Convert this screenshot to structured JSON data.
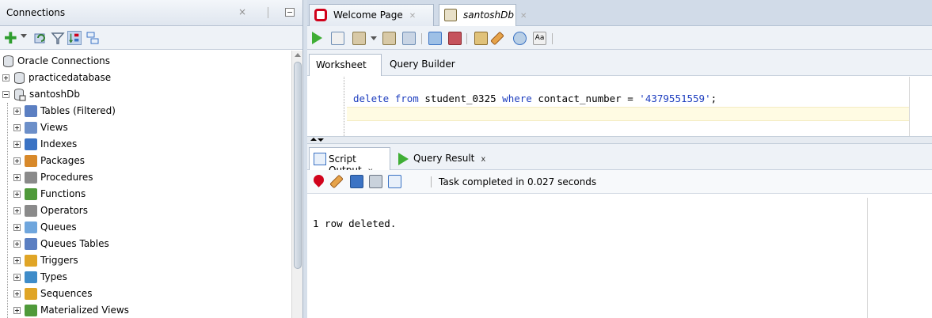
{
  "connections_panel": {
    "title": "Connections",
    "close_glyph": "×",
    "toolbar_icons": [
      "add-connection-icon",
      "refresh-icon",
      "filter-icon",
      "schema-browser-icon",
      "hierarchy-icon"
    ]
  },
  "tree": {
    "root": "Oracle Connections",
    "connections": [
      {
        "label": "practicedatabase",
        "expanded": false
      },
      {
        "label": "santoshDb",
        "expanded": true
      }
    ],
    "children": [
      {
        "label": "Tables (Filtered)",
        "icon": "tables-icon",
        "color": "#5b7fc2"
      },
      {
        "label": "Views",
        "icon": "views-icon",
        "color": "#6c8fc9"
      },
      {
        "label": "Indexes",
        "icon": "indexes-icon",
        "color": "#3b73c4"
      },
      {
        "label": "Packages",
        "icon": "packages-icon",
        "color": "#d8892a"
      },
      {
        "label": "Procedures",
        "icon": "procedures-icon",
        "color": "#7a7a7a"
      },
      {
        "label": "Functions",
        "icon": "functions-icon",
        "color": "#4f9a3a"
      },
      {
        "label": "Operators",
        "icon": "operators-icon",
        "color": "#7a7a7a"
      },
      {
        "label": "Queues",
        "icon": "queues-icon",
        "color": "#6fa6dd"
      },
      {
        "label": "Queues Tables",
        "icon": "queues-tables-icon",
        "color": "#5b7fc2"
      },
      {
        "label": "Triggers",
        "icon": "triggers-icon",
        "color": "#e0a526"
      },
      {
        "label": "Types",
        "icon": "types-icon",
        "color": "#3f8cc9"
      },
      {
        "label": "Sequences",
        "icon": "sequences-icon",
        "color": "#e0a526"
      },
      {
        "label": "Materialized Views",
        "icon": "materialized-views-icon",
        "color": "#4f9a3a"
      }
    ]
  },
  "editor_tabs": [
    {
      "label": "Welcome Page",
      "icon": "oracle-icon",
      "active": false
    },
    {
      "label": "santoshDb",
      "icon": "sql-worksheet-icon",
      "active": true
    }
  ],
  "editor_subtabs": [
    "Worksheet",
    "Query Builder"
  ],
  "sql": {
    "kw1": "delete",
    "kw2": "from",
    "table": "student_0325",
    "kw3": "where",
    "column": "contact_number",
    "op": "=",
    "value": "'4379551559'",
    "end": ";"
  },
  "output_tabs": [
    {
      "label": "Script Output",
      "close": "x",
      "active": true
    },
    {
      "label": "Query Result",
      "close": "x",
      "active": false
    }
  ],
  "output": {
    "status": "Task completed in 0.027 seconds",
    "result_text": "1 row deleted."
  },
  "colors": {
    "run_green": "#3fae35",
    "keyword_blue": "#1f3fbf",
    "oracle_red": "#d0021b"
  }
}
